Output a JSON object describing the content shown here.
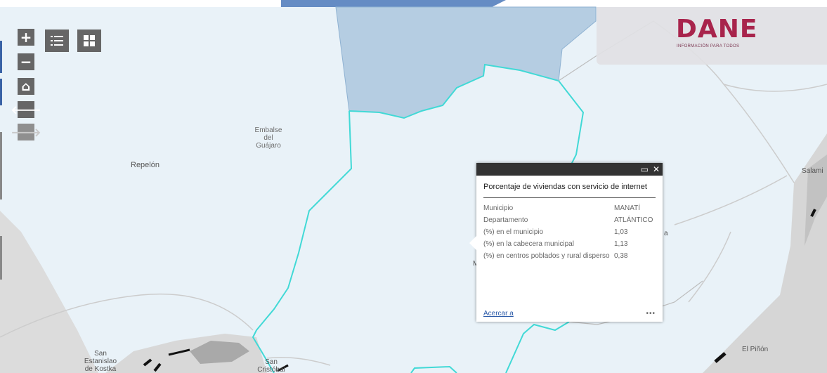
{
  "logo": {
    "text": "DANE",
    "tagline": "INFORMACIÓN PARA TODOS"
  },
  "controls": {
    "zoom_in": "+",
    "zoom_out": "−",
    "home": "⌂",
    "back": "🡐",
    "forward": "🡒",
    "legend_icon": "list-icon",
    "basemap_icon": "grid-icon"
  },
  "places": {
    "repelon": "Repelón",
    "embalse": [
      "Embalse",
      "del",
      "Guájaro"
    ],
    "salamina": "Salami",
    "el_pinon": "El Piñón",
    "san_estanislao": [
      "San",
      "Estanislao",
      "de Kostka"
    ],
    "san_cristobal": [
      "San",
      "Cristóbal"
    ],
    "hidden_m": "M",
    "hidden_a": "a"
  },
  "popup": {
    "title": "Porcentaje de viviendas con servicio de internet",
    "rows": [
      {
        "key": "Municipio",
        "value": "MANATÍ"
      },
      {
        "key": "Departamento",
        "value": "ATLÁNTICO"
      },
      {
        "key": "(%) en el municipio",
        "value": "1,03"
      },
      {
        "key": "(%) en la cabecera municipal",
        "value": "1,13"
      },
      {
        "key": "(%) en centros poblados y rural disperso",
        "value": "0,38"
      }
    ],
    "zoom_label": "Acercar a",
    "more_label": "•••",
    "maximize_icon": "▭",
    "close_icon": "✕"
  },
  "colors": {
    "land": "#e9f2f8",
    "water": "#b5cde2",
    "boundary": "#41d9d6",
    "road": "#c8c8c8"
  }
}
